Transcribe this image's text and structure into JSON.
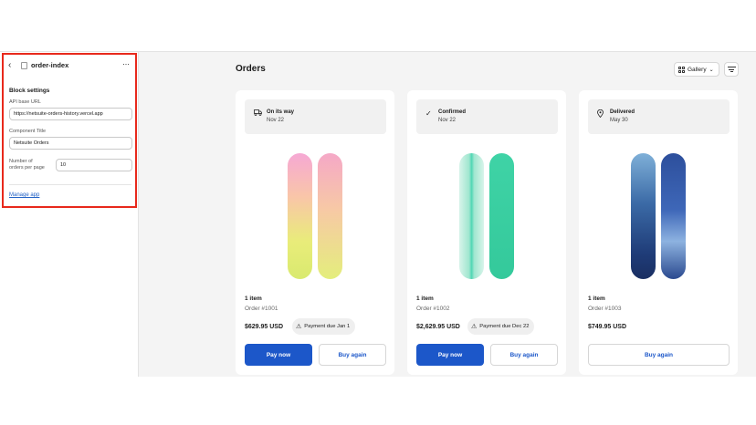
{
  "sidebar": {
    "panel_title": "order-index",
    "section_title": "Block settings",
    "api_label": "API base URL",
    "api_value": "https://netsuite-orders-history.vercel.app",
    "title_label": "Component Title",
    "title_value": "Netsuite Orders",
    "per_page_label_1": "Number of",
    "per_page_label_2": "orders per page",
    "per_page_value": "10",
    "manage_link": "Manage app",
    "highlight_color": "#e8291c"
  },
  "main": {
    "heading": "Orders",
    "view_label": "Gallery",
    "orders": [
      {
        "status": "On its way",
        "date": "Nov 22",
        "items": "1 item",
        "order_number": "Order #1001",
        "price": "$629.95 USD",
        "payment_note": "Payment due Jan 1",
        "pay_label": "Pay now",
        "buy_label": "Buy again",
        "status_icon": "truck-icon"
      },
      {
        "status": "Confirmed",
        "date": "Nov 22",
        "items": "1 item",
        "order_number": "Order #1002",
        "price": "$2,629.95 USD",
        "payment_note": "Payment due Dec 22",
        "pay_label": "Pay now",
        "buy_label": "Buy again",
        "status_icon": "check-icon"
      },
      {
        "status": "Delivered",
        "date": "May 30",
        "items": "1 item",
        "order_number": "Order #1003",
        "price": "$749.95 USD",
        "buy_label": "Buy again",
        "status_icon": "location-pin-icon"
      }
    ],
    "accent_color": "#1c57c9"
  }
}
